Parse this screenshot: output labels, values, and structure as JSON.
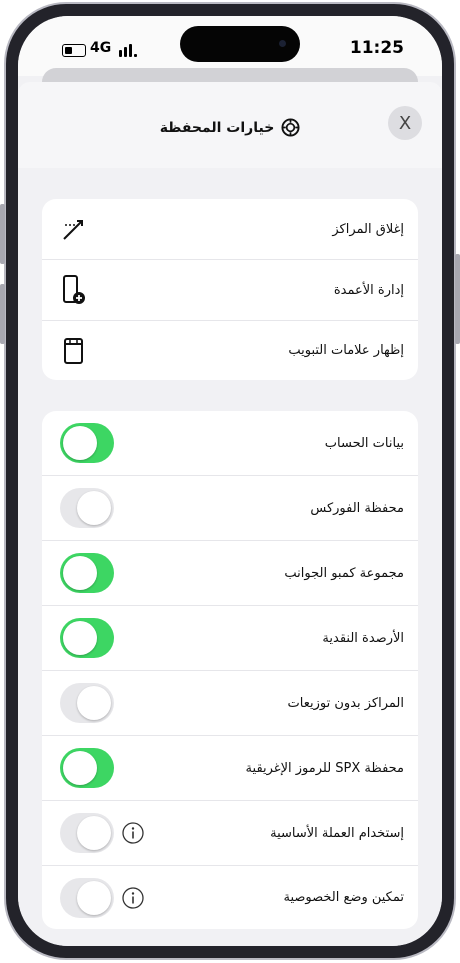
{
  "status": {
    "network": "4G",
    "time": "11:25"
  },
  "header": {
    "title": "خيارات المحفظة",
    "title_icon": "wallet-settings-icon",
    "close_label": "X"
  },
  "menu": [
    {
      "label": "إغلاق المراكز",
      "icon": "close-positions-icon"
    },
    {
      "label": "إدارة الأعمدة",
      "icon": "add-column-icon"
    },
    {
      "label": "إظهار علامات التبويب",
      "icon": "tabs-icon"
    }
  ],
  "toggles": [
    {
      "label": "بيانات الحساب",
      "on": true,
      "info": false
    },
    {
      "label": "محفظة الفوركس",
      "on": false,
      "info": false
    },
    {
      "label": "مجموعة كمبو الجوانب",
      "on": true,
      "info": false
    },
    {
      "label": "الأرصدة النقدية",
      "on": true,
      "info": false
    },
    {
      "label": "المراكز بدون توزيعات",
      "on": false,
      "info": false
    },
    {
      "label": "محفظة SPX للرموز الإغريقية",
      "on": true,
      "info": false
    },
    {
      "label": "إستخدام العملة الأساسية",
      "on": false,
      "info": true
    },
    {
      "label": "تمكين وضع الخصوصية",
      "on": false,
      "info": true
    }
  ],
  "colors": {
    "toggle_on": "#3dd663",
    "toggle_off": "#e7e7ea",
    "card": "#ffffff",
    "background": "#f1f1f4"
  }
}
